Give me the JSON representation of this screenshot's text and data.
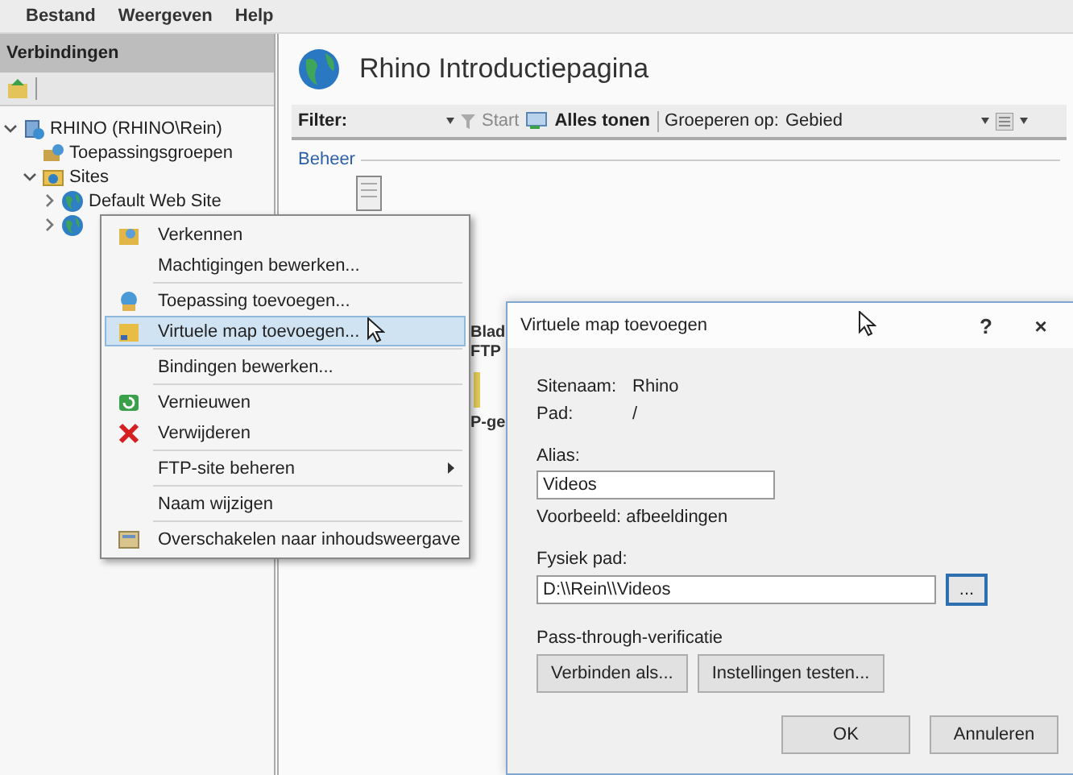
{
  "menu_bar": [
    {
      "label": "Bestand"
    },
    {
      "label": "Weergeven"
    },
    {
      "label": "Help"
    }
  ],
  "connections": {
    "title": "Verbindingen",
    "tree": [
      {
        "label": "RHINO (RHINO\\Rein)",
        "kind": "server",
        "expanded": true,
        "children": [
          {
            "label": "Toepassingsgroepen",
            "kind": "pools"
          },
          {
            "label": "Sites",
            "kind": "sites",
            "expanded": true,
            "children": [
              {
                "label": "Default Web Site",
                "kind": "site",
                "expanded": false
              },
              {
                "kind": "site",
                "expanded": false
              }
            ]
          }
        ]
      }
    ]
  },
  "main": {
    "title": "Rhino Introductiepagina",
    "filter_label": "Filter:",
    "start_label": "Start",
    "show_all_label": "Alles tonen",
    "group_by_label": "Groeperen op:",
    "group_by_value": "Gebied",
    "section": "Beheer",
    "feature_labels": [
      "Blad",
      "FTP",
      "P-ge"
    ]
  },
  "context_menu": [
    {
      "kind": "item",
      "label": "Verkennen",
      "selected": false
    },
    {
      "kind": "item",
      "label": "Machtigingen bewerken...",
      "selected": false
    },
    {
      "kind": "separator"
    },
    {
      "kind": "item",
      "label": "Toepassing toevoegen...",
      "selected": false
    },
    {
      "kind": "item",
      "label": "Virtuele map toevoegen...",
      "selected": true
    },
    {
      "kind": "separator"
    },
    {
      "kind": "item",
      "label": "Bindingen bewerken...",
      "selected": false
    },
    {
      "kind": "separator"
    },
    {
      "kind": "item",
      "label": "Vernieuwen",
      "selected": false
    },
    {
      "kind": "item",
      "label": "Verwijderen",
      "selected": false
    },
    {
      "kind": "separator"
    },
    {
      "kind": "item",
      "label": "FTP-site beheren",
      "selected": false,
      "submenu": true
    },
    {
      "kind": "separator"
    },
    {
      "kind": "item",
      "label": "Naam wijzigen",
      "selected": false
    },
    {
      "kind": "separator"
    },
    {
      "kind": "item",
      "label": "Overschakelen naar inhoudsweergave",
      "selected": false
    }
  ],
  "dialog": {
    "title": "Virtuele map toevoegen",
    "help_label": "?",
    "close_label": "×",
    "site_name_label": "Sitenaam:",
    "site_name": "Rhino",
    "path_label": "Pad:",
    "path": "/",
    "alias_label": "Alias:",
    "alias": "Videos",
    "alias_example": "Voorbeeld: afbeeldingen",
    "physical_path_label": "Fysiek pad:",
    "physical_path": "D:\\\\Rein\\\\Videos",
    "browse_label": "...",
    "browse_focused": true,
    "pass_through_label": "Pass-through-verificatie",
    "buttons": [
      {
        "label": "Verbinden als...",
        "kind": "left"
      },
      {
        "label": "Instellingen testen...",
        "kind": "left"
      },
      {
        "label": "OK",
        "kind": "right"
      },
      {
        "label": "Annuleren",
        "kind": "right"
      }
    ]
  }
}
